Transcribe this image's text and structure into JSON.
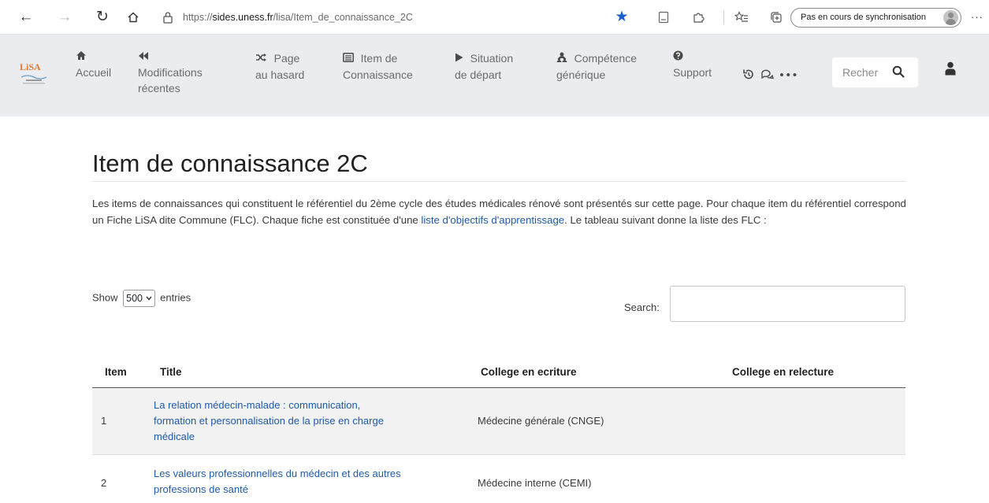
{
  "browser": {
    "url_prefix": "https://",
    "url_host": "sides.uness.fr",
    "url_path": "/lisa/Item_de_connaissance_2C",
    "sync_label": "Pas en cours de synchronisation",
    "more_label": "···"
  },
  "site": {
    "logo_text": "LiSA",
    "nav": [
      {
        "label_line1": "Accueil",
        "label_line2": "",
        "label_line3": ""
      },
      {
        "label_line1": "Modifications",
        "label_line2": "récentes",
        "label_line3": ""
      },
      {
        "label_line1": "Page",
        "label_line2": "au hasard",
        "label_line3": ""
      },
      {
        "label_line1": "Item de",
        "label_line2": "Connaissance",
        "label_line3": ""
      },
      {
        "label_line1": "Situation",
        "label_line2": "de départ",
        "label_line3": ""
      },
      {
        "label_line1": "Compétence",
        "label_line2": "générique",
        "label_line3": ""
      },
      {
        "label_line1": "Support",
        "label_line2": "",
        "label_line3": ""
      }
    ],
    "tools_more": "•••",
    "search_placeholder": "Recher"
  },
  "content": {
    "title": "Item de connaissance 2C",
    "intro_before_link": "Les items de connaissances qui constituent le référentiel du 2ème cycle des études médicales rénové sont présentés sur cette page. Pour chaque item du référentiel correspond un Fiche LiSA dite Commune (FLC). Chaque fiche est constituée d'une ",
    "intro_link": "liste d'objectifs d'apprentissage",
    "intro_after_link": ". Le tableau suivant donne la liste des FLC :"
  },
  "table": {
    "show_label": "Show",
    "show_value": "500",
    "entries_label": "entries",
    "search_label": "Search:",
    "headers": [
      "Item",
      "Title",
      "College en ecriture",
      "College en relecture"
    ],
    "rows": [
      {
        "item": "1",
        "title_line1": "La relation médecin-malade : communication,",
        "title_line2": "formation et personnalisation de la prise en charge",
        "title_line3": "médicale",
        "ecriture": "Médecine générale (CNGE)",
        "relecture": ""
      },
      {
        "item": "2",
        "title_line1": "Les valeurs professionnelles du médecin et des autres",
        "title_line2": "professions de santé",
        "title_line3": "",
        "ecriture": "Médecine interne (CEMI)",
        "relecture": ""
      }
    ]
  },
  "colors": {
    "navbar_bg": "#eaecf0",
    "link": "#1f5aa8",
    "favorite_star": "#1a5fd0",
    "logo_orange": "#e07a2b"
  },
  "icons": {
    "back": "arrow-left-icon",
    "forward": "arrow-right-icon",
    "reload": "reload-icon",
    "home": "home-icon",
    "lock": "lock-icon",
    "favorite": "star-icon",
    "reader": "reader-icon",
    "extensions": "puzzle-icon",
    "favorites_list": "favorites-list-icon",
    "collections": "collections-icon",
    "nav_home": "home-icon",
    "recent": "backward-icon",
    "random": "shuffle-icon",
    "knowledge": "list-icon",
    "situation": "play-icon",
    "competence": "users-icon",
    "support": "question-icon",
    "history": "history-icon",
    "discussion": "chat-icon",
    "search": "search-icon",
    "user": "user-icon"
  }
}
